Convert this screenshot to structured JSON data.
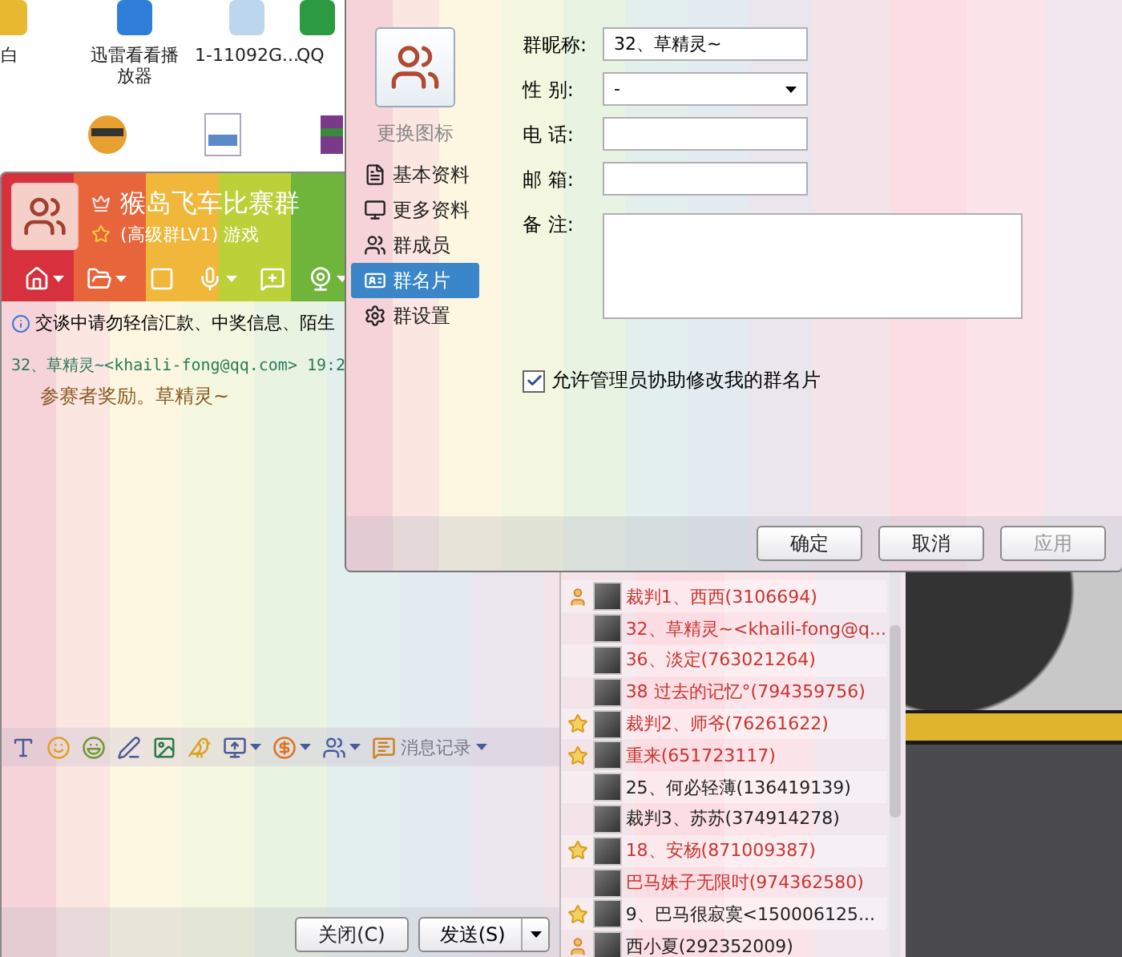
{
  "desktop": {
    "icons": [
      {
        "label": "白"
      },
      {
        "label": "迅雷看看播放器"
      },
      {
        "label": "1-11092G..."
      },
      {
        "label": "QQ"
      }
    ]
  },
  "chat_window": {
    "title": "猴岛飞车比赛群",
    "subtitle": "(高级群LV1) 游戏",
    "notice": "交谈中请勿轻信汇款、中奖信息、陌生",
    "messages": [
      {
        "header": "32、草精灵~<khaili-fong@qq.com>  19:2",
        "text": "参赛者奖励。草精灵~"
      }
    ],
    "history_label": "消息记录",
    "buttons": [
      {
        "label": "关闭(C)",
        "kind": "plain"
      },
      {
        "label": "发送(S)",
        "kind": "split"
      }
    ]
  },
  "member_list": [
    {
      "name": "裁判1、西西(3106694)",
      "kind": "owner",
      "highlighted": true
    },
    {
      "name": "32、草精灵~<khaili-fong@q...",
      "kind": "member",
      "highlighted": true
    },
    {
      "name": "36、淡定(763021264)",
      "kind": "member",
      "highlighted": true
    },
    {
      "name": "38 过去的记忆°(794359756)",
      "kind": "member",
      "highlighted": true
    },
    {
      "name": "裁判2、师爷(76261622)",
      "kind": "admin",
      "highlighted": true
    },
    {
      "name": "重来(651723117)",
      "kind": "admin",
      "highlighted": true
    },
    {
      "name": "25、何必轻薄(136419139)",
      "kind": "member",
      "highlighted": false
    },
    {
      "name": "裁判3、苏苏(374914278)",
      "kind": "member",
      "highlighted": false
    },
    {
      "name": "18、安杨(871009387)",
      "kind": "admin",
      "highlighted": true
    },
    {
      "name": "巴马妹子无限吋(974362580)",
      "kind": "member",
      "highlighted": true
    },
    {
      "name": "9、巴马很寂寞<150006125...",
      "kind": "admin",
      "highlighted": false
    },
    {
      "name": "西小夏(292352009)",
      "kind": "owner",
      "highlighted": false
    }
  ],
  "dialog": {
    "avatar_label": "更换图标",
    "nav": [
      {
        "label": "基本资料",
        "selected": false
      },
      {
        "label": "更多资料",
        "selected": false
      },
      {
        "label": "群成员",
        "selected": false
      },
      {
        "label": "群名片",
        "selected": true
      },
      {
        "label": "群设置",
        "selected": false
      }
    ],
    "fields": [
      {
        "label": "群昵称:",
        "kind": "text",
        "value": "32、草精灵~"
      },
      {
        "label": "性 别:",
        "kind": "select",
        "value": "-"
      },
      {
        "label": "电 话:",
        "kind": "text"
      },
      {
        "label": "邮 箱:",
        "kind": "text"
      },
      {
        "label": "备 注:",
        "kind": "area"
      }
    ],
    "allow_admin_edit": {
      "label": "允许管理员协助修改我的群名片",
      "checked": true
    },
    "buttons": [
      {
        "label": "确定",
        "disabled": false
      },
      {
        "label": "取消",
        "disabled": false
      },
      {
        "label": "应用",
        "disabled": true
      }
    ]
  }
}
